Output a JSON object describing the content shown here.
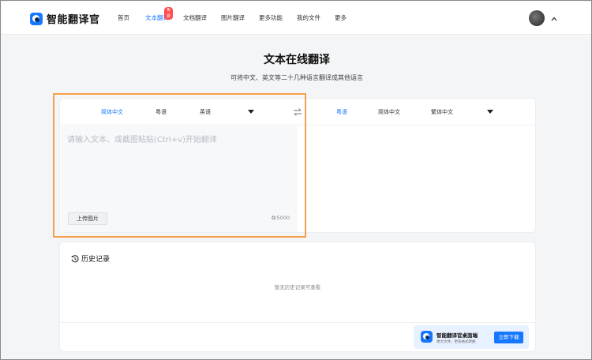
{
  "app": {
    "name": "智能翻译官",
    "brand_color": "#1677ff",
    "logo_icon": "translate-logo-icon"
  },
  "nav": {
    "items": [
      {
        "label": "首页"
      },
      {
        "label": "文本翻译",
        "active": true,
        "badge": "免费"
      },
      {
        "label": "文档翻译"
      },
      {
        "label": "图片翻译"
      },
      {
        "label": "更多功能"
      },
      {
        "label": "我的文件"
      },
      {
        "label": "更多"
      }
    ]
  },
  "user": {
    "avatar_icon": "user-avatar",
    "menu_icon": "chevron-up-icon"
  },
  "page": {
    "title": "文本在线翻译",
    "subtitle": "可将中文、英文等二十几种语言翻译成其他语言"
  },
  "translator": {
    "source_langs": [
      "简体中文",
      "粤语",
      "英语"
    ],
    "source_active": "简体中文",
    "target_langs": [
      "粤语",
      "简体中文",
      "繁体中文"
    ],
    "target_active": "粤语",
    "swap_icon": "swap-arrows-icon",
    "input_value": "",
    "input_placeholder": "请输入文本、或截图粘贴(Ctrl+v)开始翻译",
    "upload_label": "上传图片",
    "char_count_current": "0",
    "char_count_max": "/5000"
  },
  "history": {
    "title": "历史记录",
    "empty_text": "暂无历史记录可查看",
    "icon": "history-clock-icon"
  },
  "promo": {
    "title": "智能翻译官桌面端",
    "subtitle": "更大文件，更多格式转换",
    "button_label": "立即下载"
  },
  "annotation": {
    "highlight_color": "#f5a04a"
  }
}
